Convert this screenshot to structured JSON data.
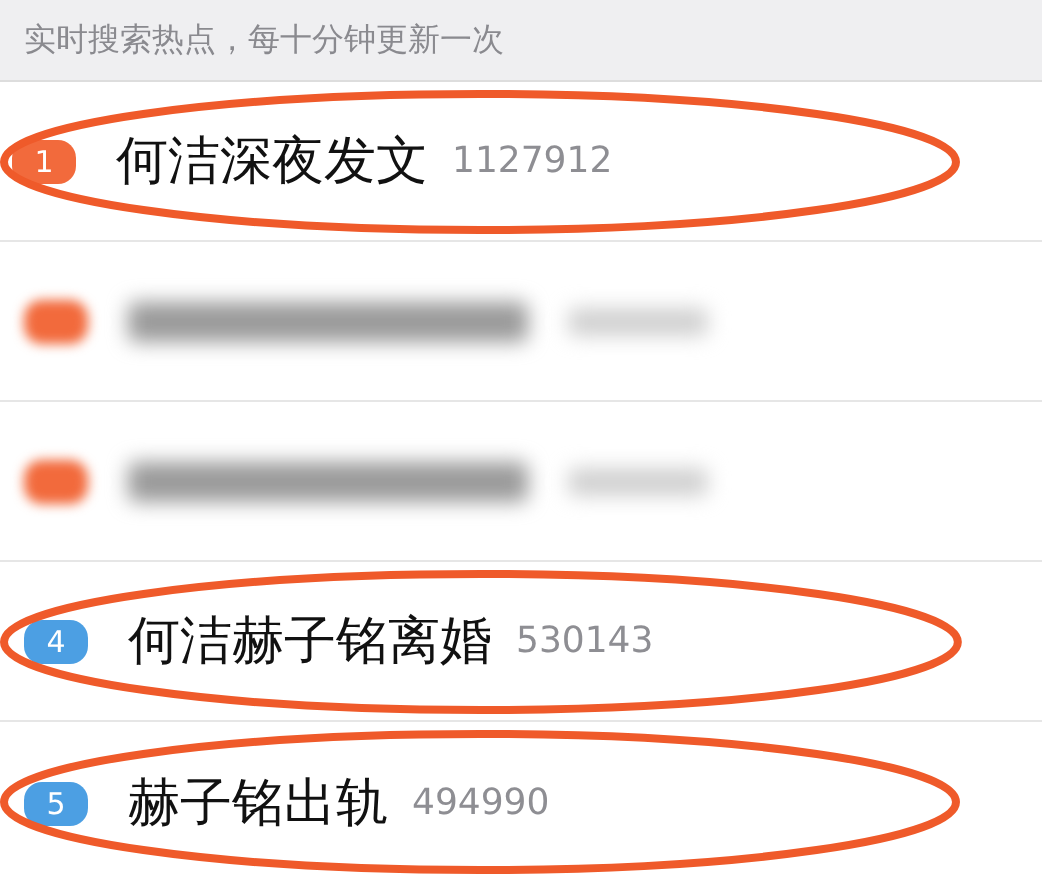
{
  "header": {
    "text": "实时搜索热点，每十分钟更新一次"
  },
  "rows": [
    {
      "kind": "entry",
      "rank": "1",
      "title": "何洁深夜发文",
      "count": "1127912",
      "color": "#f26a3c",
      "circled": true
    },
    {
      "kind": "blurred",
      "color": "#f26a3c",
      "circled": false
    },
    {
      "kind": "blurred",
      "color": "#f26a3c",
      "circled": false
    },
    {
      "kind": "entry",
      "rank": "4",
      "title": "何洁赫子铭离婚",
      "count": "530143",
      "color": "#4c9fe3",
      "circled": true
    },
    {
      "kind": "entry",
      "rank": "5",
      "title": "赫子铭出轨",
      "count": "494990",
      "color": "#4c9fe3",
      "circled": true
    }
  ]
}
